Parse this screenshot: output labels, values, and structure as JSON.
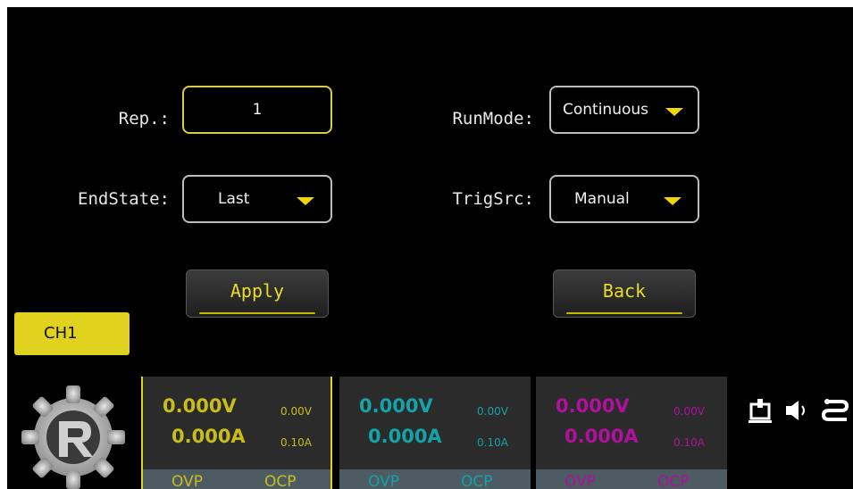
{
  "form": {
    "rep_label": "Rep.:",
    "rep_value": "1",
    "runmode_label": "RunMode:",
    "runmode_value": "Continuous",
    "endstate_label": "EndState:",
    "endstate_value": "Last",
    "trigsrc_label": "TrigSrc:",
    "trigsrc_value": "Manual"
  },
  "buttons": {
    "apply": "Apply",
    "back": "Back"
  },
  "channel_tab": "CH1",
  "channels": [
    {
      "voltage": "0.000V",
      "current": "0.000A",
      "set_voltage": "0.00V",
      "set_current": "0.10A",
      "ovp": "OVP",
      "ocp": "OCP",
      "color": "#c8bd1c"
    },
    {
      "voltage": "0.000V",
      "current": "0.000A",
      "set_voltage": "0.00V",
      "set_current": "0.10A",
      "ovp": "OVP",
      "ocp": "OCP",
      "color": "#13a3a8"
    },
    {
      "voltage": "0.000V",
      "current": "0.000A",
      "set_voltage": "0.00V",
      "set_current": "0.10A",
      "ovp": "OVP",
      "ocp": "OCP",
      "color": "#b0109c"
    }
  ],
  "status_icons": [
    "usb-device-icon",
    "speaker-icon",
    "network-icon"
  ],
  "colors": {
    "accent": "#e0d21e",
    "background": "#000000",
    "panel": "#2b2b2b",
    "strip": "#4d5b63"
  }
}
